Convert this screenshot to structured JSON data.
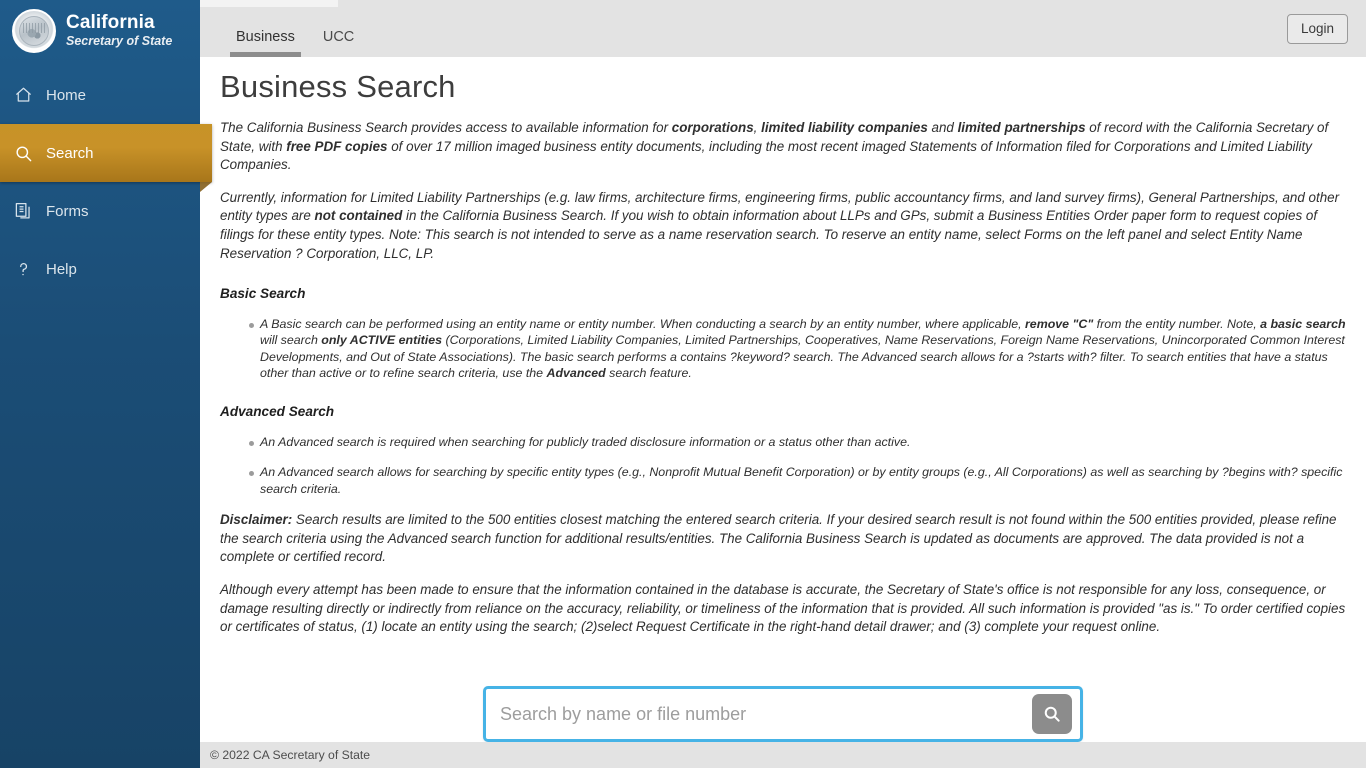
{
  "brand": {
    "line1": "California",
    "line2": "Secretary of State",
    "seal_icon": "california-state-seal-icon"
  },
  "sidebar": {
    "items": [
      {
        "label": "Home",
        "icon": "home-icon",
        "active": false
      },
      {
        "label": "Search",
        "icon": "search-icon",
        "active": true
      },
      {
        "label": "Forms",
        "icon": "forms-icon",
        "active": false
      },
      {
        "label": "Help",
        "icon": "help-icon",
        "active": false
      }
    ],
    "background_color": "#1b4d76",
    "active_color": "#c89228"
  },
  "topbar": {
    "tabs": [
      {
        "label": "Business",
        "active": true
      },
      {
        "label": "UCC",
        "active": false
      }
    ],
    "login_label": "Login"
  },
  "main": {
    "title": "Business Search",
    "intro": {
      "t1": "The California Business Search provides access to available information for ",
      "b1": "corporations",
      "t2": ", ",
      "b2": "limited liability companies",
      "t3": " and ",
      "b3": "limited partnerships",
      "t4": " of record with the California Secretary of State, with ",
      "b4": "free PDF copies",
      "t5": " of over 17 million imaged business entity documents, including the most recent imaged Statements of Information filed for Corporations and Limited Liability Companies."
    },
    "currently": {
      "t1": "Currently, information for Limited Liability Partnerships (e.g. law firms, architecture firms, engineering firms, public accountancy firms, and land survey firms), General Partnerships, and other entity types are ",
      "b1": "not contained",
      "t2": " in the California Business Search. If you wish to obtain information about LLPs and GPs, submit a Business Entities Order paper form to request copies of filings for these entity types. Note: This search is not intended to serve as a name reservation search. To reserve an entity name, select Forms on the left panel and select Entity Name Reservation ? Corporation, LLC, LP."
    },
    "basic_search": {
      "heading": "Basic Search",
      "bullet": {
        "t1": "A Basic search can be performed using an entity name or entity number. When conducting a search by an entity number, where applicable, ",
        "b1": "remove \"C\"",
        "t2": " from the entity number. Note, ",
        "b2": "a basic search",
        "t3": " will search ",
        "b3": "only ACTIVE entities",
        "t4": " (Corporations, Limited Liability Companies, Limited Partnerships, Cooperatives, Name Reservations, Foreign Name Reservations, Unincorporated Common Interest Developments, and Out of State Associations). The basic search performs a contains ?keyword? search. The Advanced search allows for a ?starts with? filter. To search entities that have a status other than active or to refine search criteria, use the ",
        "b4": "Advanced",
        "t5": " search feature."
      }
    },
    "advanced_search": {
      "heading": "Advanced Search",
      "bullets": [
        "An Advanced search is required when searching for publicly traded disclosure information or a status other than active.",
        "An Advanced search allows for searching by specific entity types (e.g., Nonprofit Mutual Benefit Corporation) or by entity groups (e.g., All Corporations) as well as searching by ?begins with? specific search criteria."
      ]
    },
    "disclaimer": {
      "label": "Disclaimer:",
      "text": " Search results are limited to the 500 entities closest matching the entered search criteria. If your desired search result is not found within the 500 entities provided, please refine the search criteria using the Advanced search function for additional results/entities. The California Business Search is updated as documents are approved. The data provided is not a complete or certified record."
    },
    "legal": "Although every attempt has been made to ensure that the information contained in the database is accurate, the Secretary of State's office is not responsible for any loss, consequence, or damage resulting directly or indirectly from reliance on the accuracy, reliability, or timeliness of the information that is provided. All such information is provided \"as is.\" To order certified copies or certificates of status, (1) locate an entity using the search; (2)select Request Certificate in the right-hand detail drawer; and (3) complete your request online."
  },
  "search": {
    "placeholder": "Search by name or file number",
    "value": "",
    "button_icon": "search-icon",
    "focus_color": "#46b3e6"
  },
  "footer": {
    "copyright": "© 2022 CA Secretary of State"
  }
}
